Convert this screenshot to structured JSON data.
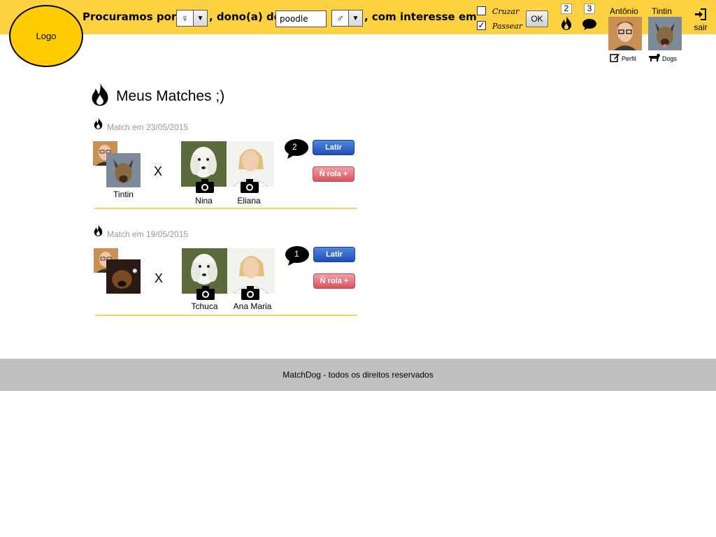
{
  "header": {
    "logo": "Logo",
    "search_prefix": "Procuramos por",
    "search_mid": ", dono(a) de",
    "search_suffix": ", com interesse em",
    "gender_pet": "♀",
    "gender_owner": "♂",
    "breed_value": "poodle",
    "options": [
      {
        "label": "Cruzar",
        "checked": false
      },
      {
        "label": "Passear",
        "checked": true
      }
    ],
    "ok_label": "OK",
    "matches_count": "2",
    "messages_count": "3",
    "user_name": "Antônio",
    "dog_name": "Tintin",
    "profile_link": "Perfil",
    "dogs_link": "Dogs",
    "logout": "sair"
  },
  "page_title": "Meus Matches ;)",
  "matches": [
    {
      "date": "Match em 23/05/2015",
      "my_dog": "Tintin",
      "their_dog": "Nina",
      "their_owner": "Eliana",
      "messages": "2",
      "latir": "Latir",
      "nrola": "Ñ rola +"
    },
    {
      "date": "Match em 19/05/2015",
      "my_dog": "",
      "their_dog": "Tchuca",
      "their_owner": "Ana Maria",
      "messages": "1",
      "latir": "Latir",
      "nrola": "Ñ rola +"
    }
  ],
  "x_mark": "X",
  "footer": "MatchDog - todos os direitos reservados",
  "colors": {
    "header": "#fdd13f",
    "logo": "#ffcc00",
    "latir": "#1f4fb8",
    "nrola": "#d8545d",
    "footer": "#c0c0c0"
  }
}
